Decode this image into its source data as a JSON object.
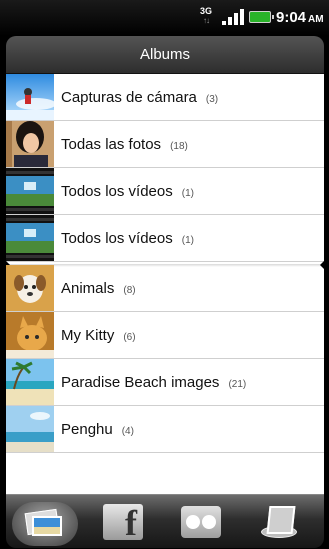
{
  "status_bar": {
    "network": "3G",
    "network_arrows": "↑↓",
    "time": "9:04",
    "ampm": "AM",
    "signal_icon": "signal-bars-icon",
    "battery_icon": "battery-icon"
  },
  "header": {
    "title": "Albums"
  },
  "albums": [
    {
      "name": "Capturas de cámara",
      "count": "(3)",
      "thumb": "skydiver-thumbnail"
    },
    {
      "name": "Todas las fotos",
      "count": "(18)",
      "thumb": "portrait-thumbnail"
    },
    {
      "name": "Todos los vídeos",
      "count": "(1)",
      "thumb": "video-thumbnail"
    },
    {
      "name": "Todos los vídeos",
      "count": "(1)",
      "thumb": "video-thumbnail"
    },
    {
      "name": "Animals",
      "count": "(8)",
      "thumb": "puppy-thumbnail"
    },
    {
      "name": "My Kitty",
      "count": "(6)",
      "thumb": "kitten-thumbnail"
    },
    {
      "name": "Paradise Beach images",
      "count": "(21)",
      "thumb": "beach-thumbnail"
    },
    {
      "name": "Penghu",
      "count": "(4)",
      "thumb": "seaside-thumbnail"
    }
  ],
  "tabs": [
    {
      "icon": "gallery-icon",
      "active": true
    },
    {
      "icon": "facebook-icon",
      "active": false,
      "glyph": "f"
    },
    {
      "icon": "flickr-icon",
      "active": false
    },
    {
      "icon": "upload-icon",
      "active": false
    }
  ],
  "colors": {
    "battery": "#29b329",
    "list_background": "#ffffff",
    "title_bar": "#3c3c3c"
  }
}
